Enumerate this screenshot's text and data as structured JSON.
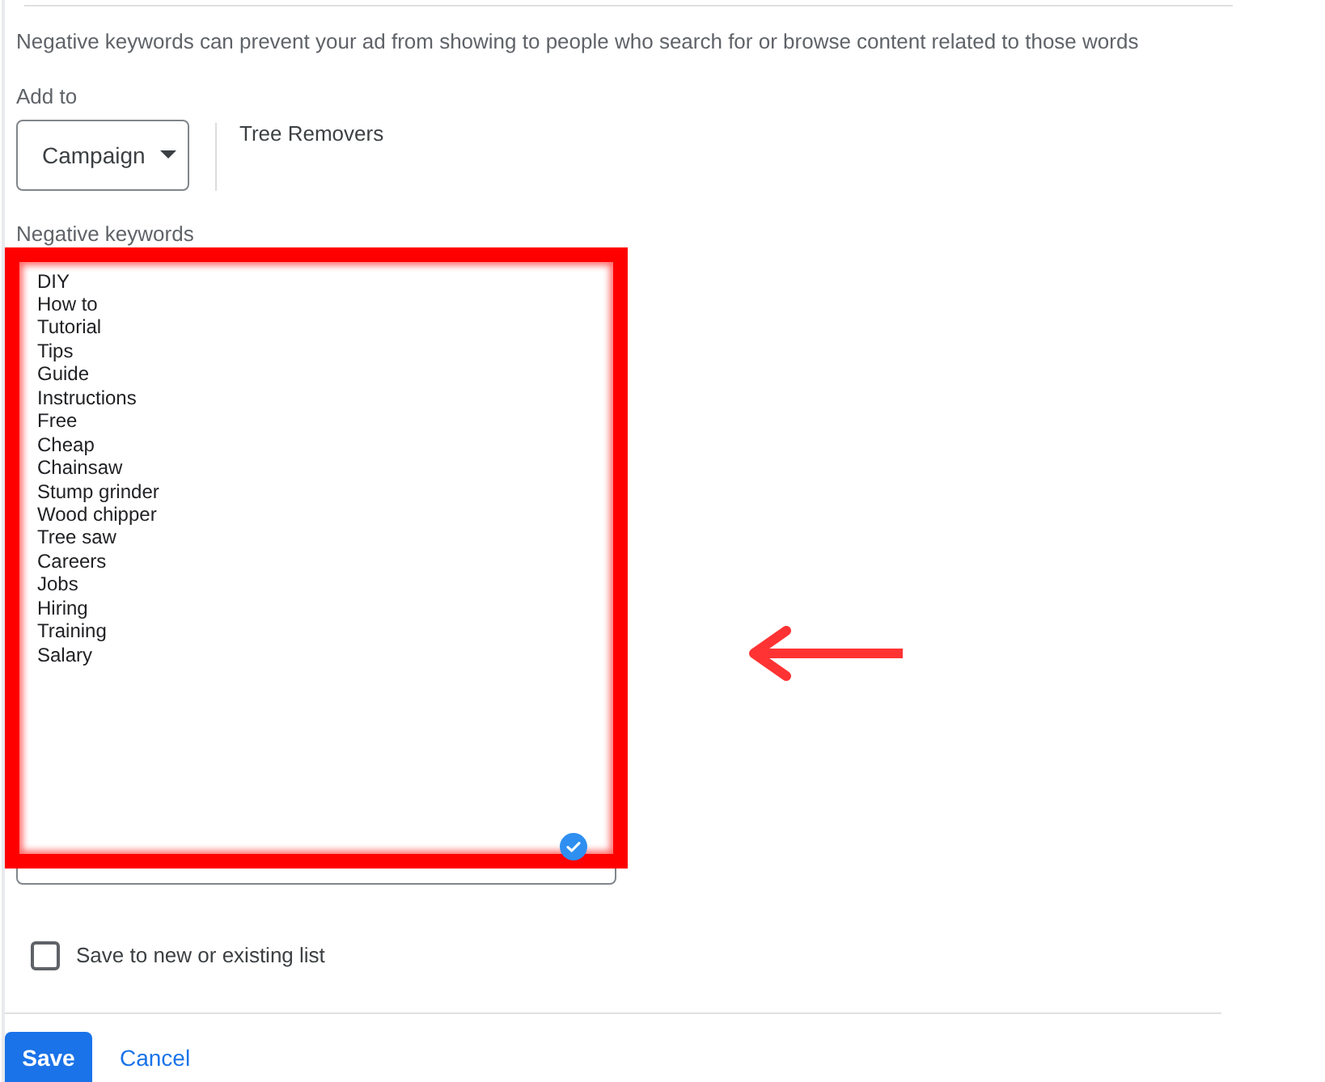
{
  "description": "Negative keywords can prevent your ad from showing to people who search for or browse content related to those words",
  "add_to": {
    "label": "Add to",
    "dropdown": {
      "value": "Campaign"
    },
    "campaign_name": "Tree Removers"
  },
  "negative_keywords": {
    "label": "Negative keywords",
    "keywords": [
      "DIY",
      "How to",
      "Tutorial",
      "Tips",
      "Guide",
      "Instructions",
      "Free",
      "Cheap",
      "Chainsaw",
      "Stump grinder",
      "Wood chipper",
      "Tree saw",
      "Careers",
      "Jobs",
      "Hiring",
      "Training",
      "Salary"
    ]
  },
  "save_to_list": {
    "label": "Save to new or existing list",
    "checked": false
  },
  "buttons": [
    {
      "label": "Save",
      "kind": "primary"
    },
    {
      "label": "Cancel",
      "kind": "text"
    }
  ]
}
